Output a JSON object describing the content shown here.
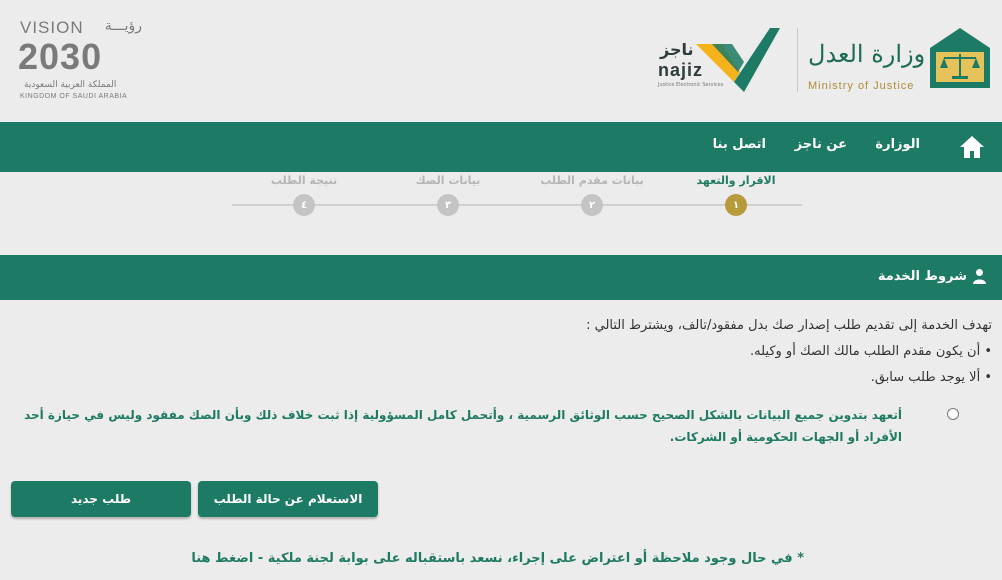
{
  "header": {
    "vision": {
      "title_en": "VISION",
      "title_ar": "رؤيـــة",
      "year": "2030",
      "country_ar": "المملكة العربية السعودية",
      "country_en": "KINGDOM OF SAUDI ARABIA"
    },
    "najiz": {
      "name_ar": "ناجز",
      "name_en": "najiz",
      "sub": "Justice Electronic Services"
    },
    "ministry": {
      "name_ar": "وزارة العدل",
      "name_en": "Ministry of Justice"
    }
  },
  "nav": {
    "home_icon": "home-icon",
    "items": [
      {
        "label": "الوزارة"
      },
      {
        "label": "عن ناجز"
      },
      {
        "label": "اتصل بنا"
      }
    ]
  },
  "stepper": {
    "steps": [
      {
        "label": "الاقرار والتعهد",
        "number": "١",
        "active": true
      },
      {
        "label": "بيانات مقدم الطلب",
        "number": "٢",
        "active": false
      },
      {
        "label": "بيانات الصك",
        "number": "٣",
        "active": false
      },
      {
        "label": "نتيجة الطلب",
        "number": "٤",
        "active": false
      }
    ]
  },
  "terms": {
    "title": "شروط الخدمة",
    "icon": "user-icon",
    "intro": "تهدف الخدمة إلى تقديم طلب إصدار صك بدل مفقود/تالف، ويشترط التالي :",
    "conditions": [
      "• أن يكون مقدم الطلب مالك الصك أو وكيله.",
      "• ألا يوجد طلب سابق."
    ],
    "pledge": "أتعهد بتدوين جميع البيانات بالشكل الصحيح حسب الوثائق الرسمية ، وأتحمل كامل المسؤولية إذا ثبت خلاف ذلك وبأن الصك مفقود وليس في حيازة أحد الأفراد أو الجهات الحكومية أو الشركات."
  },
  "buttons": {
    "inquiry": "الاستعلام عن حالة الطلب",
    "new_request": "طلب جديد"
  },
  "footer_note": "* في حال وجود ملاحظة أو اعتراض على إجراء، نسعد باستقباله على بوابة لجنة ملكية - اضغط هنا",
  "colors": {
    "primary": "#1d7a64",
    "accent_gold": "#b79a3a",
    "background": "#ececec"
  }
}
